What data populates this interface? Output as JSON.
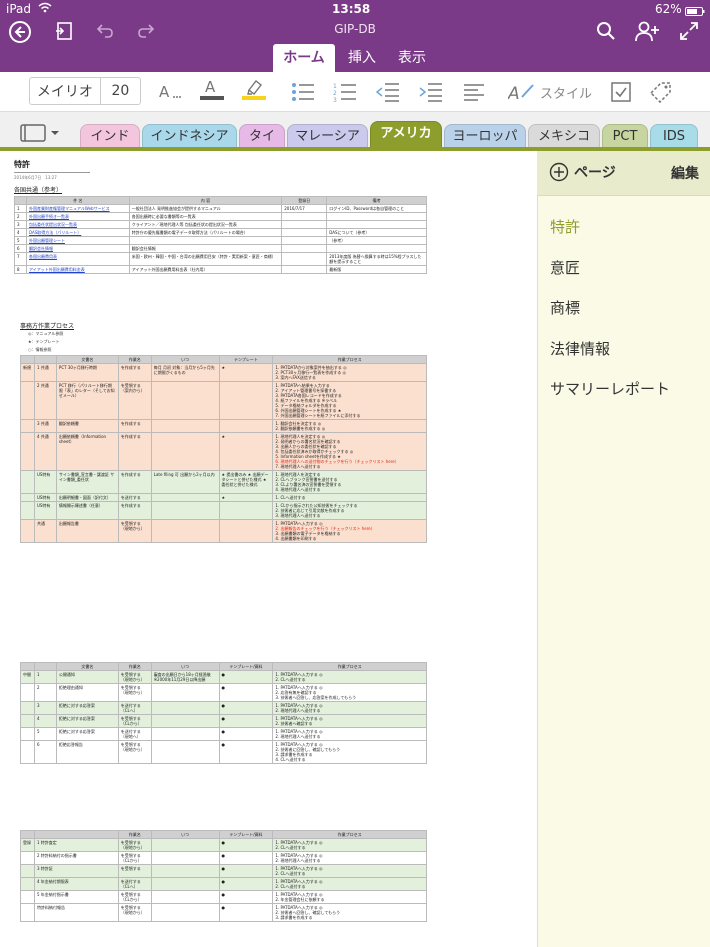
{
  "status": {
    "device": "iPad",
    "time": "13:58",
    "battery": "62%"
  },
  "app_title": "GIP-DB",
  "ribbon_tabs": [
    "ホーム",
    "挿入",
    "表示"
  ],
  "font": {
    "name": "メイリオ",
    "size": "20"
  },
  "toolbar": {
    "style_label": "スタイル"
  },
  "sections": [
    {
      "label": "インド",
      "color": "#f3c6dd"
    },
    {
      "label": "インドネシア",
      "color": "#a9d8ea"
    },
    {
      "label": "タイ",
      "color": "#e6b9e6"
    },
    {
      "label": "マレーシア",
      "color": "#cbc9ec"
    },
    {
      "label": "アメリカ",
      "color": "#8e9e2c"
    },
    {
      "label": "ヨーロッパ",
      "color": "#b9d2ea"
    },
    {
      "label": "メキシコ",
      "color": "#dadada"
    },
    {
      "label": "PCT",
      "color": "#c7d6a0"
    },
    {
      "label": "IDS",
      "color": "#a8dce9"
    }
  ],
  "pages_panel": {
    "add_label": "ページ",
    "edit_label": "編集",
    "pages": [
      "特許",
      "意匠",
      "商標",
      "法律情報",
      "サマリーレポート"
    ]
  },
  "note": {
    "title": "特許",
    "date": "2014年6月7日　13:27",
    "section1_heading": "各国共通（参考）",
    "table1": {
      "headers": [
        "",
        "件 名",
        "内 容",
        "登録日",
        "備考"
      ],
      "rows": [
        [
          "1",
          "外国産業財産権管理マニュアルWebサービス",
          "一般社団法人 発明推進協会が提供するマニュアル",
          "2016/7/17",
          "ログインID、Passwordは各自管理のこと"
        ],
        [
          "2",
          "外国出願手続き一覧表",
          "各国出願時に必要な書類等の一覧表",
          "",
          ""
        ],
        [
          "3",
          "包括委任状提出状況一覧表",
          "クライアント／現地代理人等 包括委任状の提出状況一覧表",
          "",
          ""
        ],
        [
          "4",
          "DAS取得方法（パリルート）",
          "特許庁の優先権書類の電子データ取得方法（パリルートの場合）",
          "",
          "DASについて（参考）"
        ],
        [
          "5",
          "外国出願管理シート",
          "",
          "",
          "（参考）"
        ],
        [
          "6",
          "翻訳会社情報",
          "翻訳会社情報",
          "",
          ""
        ],
        [
          "7",
          "各国出願費用表",
          "米国・欧州・韓国・中国・台湾の出願費用目安（特許・実用新案・意匠・商標）",
          "",
          "2013年度版 為替へ換算する時は15%程プラスした額を提示すること"
        ],
        [
          "8",
          "アイアット外国出願費用料金表",
          "アイアット外国出願費用料金表（社内用）",
          "",
          "最新版"
        ]
      ]
    },
    "section2_heading": "事務方作業プロセス",
    "legend": [
      "◎：マニュアル参照",
      "★：テンプレート",
      "○：情報参照"
    ],
    "table2": {
      "headers": [
        "",
        "",
        "文書名",
        "作業名",
        "いつ",
        "テンプレート",
        "作業プロセス"
      ],
      "rows": [
        {
          "bg": "#fbe0d0",
          "c0": "新規",
          "c1": "1 共通",
          "c2": "PCT 30ヶ月移行時期",
          "c3": "を作成する",
          "c4": "毎月 月初 対象：当月から5ヶ月先に期限がくるもの",
          "c5": "★",
          "c6": [
            "1. PATDATAから対象案件を抽出する ◎",
            "2. PCT30ヶ月移行一覧表を作成する ◎",
            "3. 案内へFAX送信する"
          ]
        },
        {
          "bg": "#fbe0d0",
          "c0": "",
          "c1": "2 共通",
          "c2": "PCT 移行（パリルート移行期限「表」のレター（そしてお知せメール）",
          "c3": "を受領する（案内から）",
          "c4": "",
          "c5": "",
          "c6": [
            "1. PATDATAへ結果を入力する",
            "2. アイアット管理番号を採番する",
            "3. PATDATA各国レコードを作成する",
            "4. 紙ファイルを作成する ※ラベル",
            "5. データ格納フォルダを作成する",
            "6. 外国出願管理シートを作成する ★",
            "7. 外国出願管理シートを紙ファイルに添付する"
          ]
        },
        {
          "bg": "#fbe0d0",
          "c0": "",
          "c1": "3 共通",
          "c2": "翻訳依頼書",
          "c3": "を作成する",
          "c4": "",
          "c5": "",
          "c6": [
            "1. 翻訳会社を決定する ◎",
            "2. 翻訳依頼書を作成する ◎"
          ]
        },
        {
          "bg": "#fbe0d0",
          "c0": "",
          "c1": "4 共通",
          "c2": "出願依頼書（Information sheet）",
          "c3": "を作成する",
          "c4": "",
          "c5": "★",
          "c6": [
            "1. 現地代理人を決定する ◎",
            "2. 発明者からの署名状況を確認する",
            "3. 出願人からの委任状を確認する",
            "4. 包括委任状済みか取得かチェックする ◎",
            "5. Information sheetを作成する ★",
            "6. 現地代理人への送付物のチェックを行う（チェックリスト here）",
            "7. 現地代理人へ送付する"
          ]
        },
        {
          "bg": "#e2f0dc",
          "c0": "",
          "c1": "US特有",
          "c2": "サイン書類_宣言書・譲渡証 サイン書類_委任状",
          "c3": "を作成する",
          "c4": "Late filing 可 出願から2ヶ月以内",
          "c5": "★ 提出書のみ ★ 出願データシートと併せた様式 ★ 委任状と併せた様式",
          "c6": [
            "1. 現地代理人を決定する",
            "2. CLへブランク宣誓書を送付する",
            "3. CLより署名済の宣誓書を受領する",
            "4. 現地代理人へ送付する"
          ]
        },
        {
          "bg": "#e2f0dc",
          "c0": "",
          "c1": "US特有",
          "c2": "出願明細書・図面（訳付文）",
          "c3": "を送付する",
          "c4": "",
          "c5": "★",
          "c6": [
            "1. CLへ送付する"
          ]
        },
        {
          "bg": "#e2f0dc",
          "c0": "",
          "c1": "US特有",
          "c2": "情報開示陳述書（任意）",
          "c3": "を作成する",
          "c4": "",
          "c5": "",
          "c6": [
            "1. CLから指示された公知技術をチェックする",
            "2. 技術者に応じて引用文献を作成する",
            "3. 現地代理人へ送付する"
          ]
        },
        {
          "bg": "#fbe0d0",
          "c0": "",
          "c1": "共通",
          "c2": "出願報告書",
          "c3": "を受領する（現地から）",
          "c4": "",
          "c5": "",
          "c6": [
            "1. PATDATAへ入力する ◎",
            "2. 出願報告のチェックを行う（チェックリスト here）",
            "3. 出願書類の電子データを格納する",
            "4. 出願書類を印刷する"
          ]
        }
      ]
    },
    "table3": {
      "headers": [
        "",
        "",
        "文書名",
        "作業名",
        "いつ",
        "テンプレート/資料",
        "作業プロセス"
      ],
      "rows": [
        {
          "bg": "#e2f0dc",
          "c0": "中間",
          "c1": "1",
          "c2": "公開通知",
          "c3": "を受領する（現地から）",
          "c4": "審査の出願日から18ヶ月経過後 ※2000年11月29日以降出願",
          "c5": "●",
          "c6": [
            "1. PATDATAへ入力する ◎",
            "2. CLへ送付する"
          ]
        },
        {
          "bg": "#fff",
          "c0": "",
          "c1": "2",
          "c2": "拒絶理由通知",
          "c3": "を受領する（現地から）",
          "c4": "",
          "c5": "●",
          "c6": [
            "1. PATDATAへ入力する ◎",
            "2. 応答有無を確認する",
            "3. 技術者へ回答し、応答案を作成してもらう"
          ]
        },
        {
          "bg": "#e2f0dc",
          "c0": "",
          "c1": "3",
          "c2": "拒絶に対する応答案",
          "c3": "を送付する（CLへ）",
          "c4": "",
          "c5": "●",
          "c6": [
            "1. PATDATAへ入力する ◎",
            "2. 現地代理人へ送付する"
          ]
        },
        {
          "bg": "#e2f0dc",
          "c0": "",
          "c1": "4",
          "c2": "拒絶に対する応答案",
          "c3": "を受領する（CLから）",
          "c4": "",
          "c5": "●",
          "c6": [
            "1. PATDATAへ入力する ◎",
            "2. 技術者へ確認する"
          ]
        },
        {
          "bg": "#fff",
          "c0": "",
          "c1": "5",
          "c2": "拒絶に対する応答案",
          "c3": "を送付する（現地へ）",
          "c4": "",
          "c5": "●",
          "c6": [
            "1. PATDATAへ入力する ◎",
            "2. 現地代理人へ送付する"
          ]
        },
        {
          "bg": "#fff",
          "c0": "",
          "c1": "6",
          "c2": "拒絶応答報告",
          "c3": "を受領する（現地から）",
          "c4": "",
          "c5": "●",
          "c6": [
            "1. PATDATAへ入力する ◎",
            "2. 技術者に回答し、確認してもらう",
            "3. 請求書を作成する",
            "4. CLへ送付する"
          ]
        }
      ]
    },
    "table4": {
      "headers": [
        "",
        "",
        "作業名",
        "いつ",
        "テンプレート/資料",
        "作業プロセス"
      ],
      "rows": [
        {
          "bg": "#e2f0dc",
          "c0": "登録",
          "c1": "1 特許査定",
          "c2": "を受領する（現地から）",
          "c3": "",
          "c4": "●",
          "c5": [
            "1. PATDATAへ入力する ◎",
            "2. CLへ送付する"
          ]
        },
        {
          "bg": "#fff",
          "c0": "",
          "c1": "2 特許料納付の指示書",
          "c2": "を受領する（CLから）",
          "c3": "",
          "c4": "●",
          "c5": [
            "1. PATDATAへ入力する ◎",
            "2. 現地代理人へ送付する"
          ]
        },
        {
          "bg": "#e2f0dc",
          "c0": "",
          "c1": "3 特許証",
          "c2": "を受領する",
          "c3": "",
          "c4": "●",
          "c5": [
            "1. PATDATAへ入力する ◎",
            "2. CLへ送付する"
          ]
        },
        {
          "bg": "#e2f0dc",
          "c0": "",
          "c1": "4 年金納付期限表",
          "c2": "を送付する（CLへ）",
          "c3": "",
          "c4": "●",
          "c5": [
            "1. PATDATAへ入力する ◎",
            "2. CLへ送付する"
          ]
        },
        {
          "bg": "#fff",
          "c0": "",
          "c1": "5 年金納付指示書",
          "c2": "を受領する（CLから）",
          "c3": "",
          "c4": "●",
          "c5": [
            "1. PATDATAへ入力する ◎",
            "2. 年金管理会社に依頼する"
          ]
        },
        {
          "bg": "#fff",
          "c0": "",
          "c1": "特許料納付報告",
          "c2": "を受領する（現地から）",
          "c3": "",
          "c4": "●",
          "c5": [
            "1. PATDATAへ入力する ◎",
            "2. 技術者へ回答し、確認してもらう",
            "3. 請求書を作成する"
          ]
        }
      ]
    }
  }
}
